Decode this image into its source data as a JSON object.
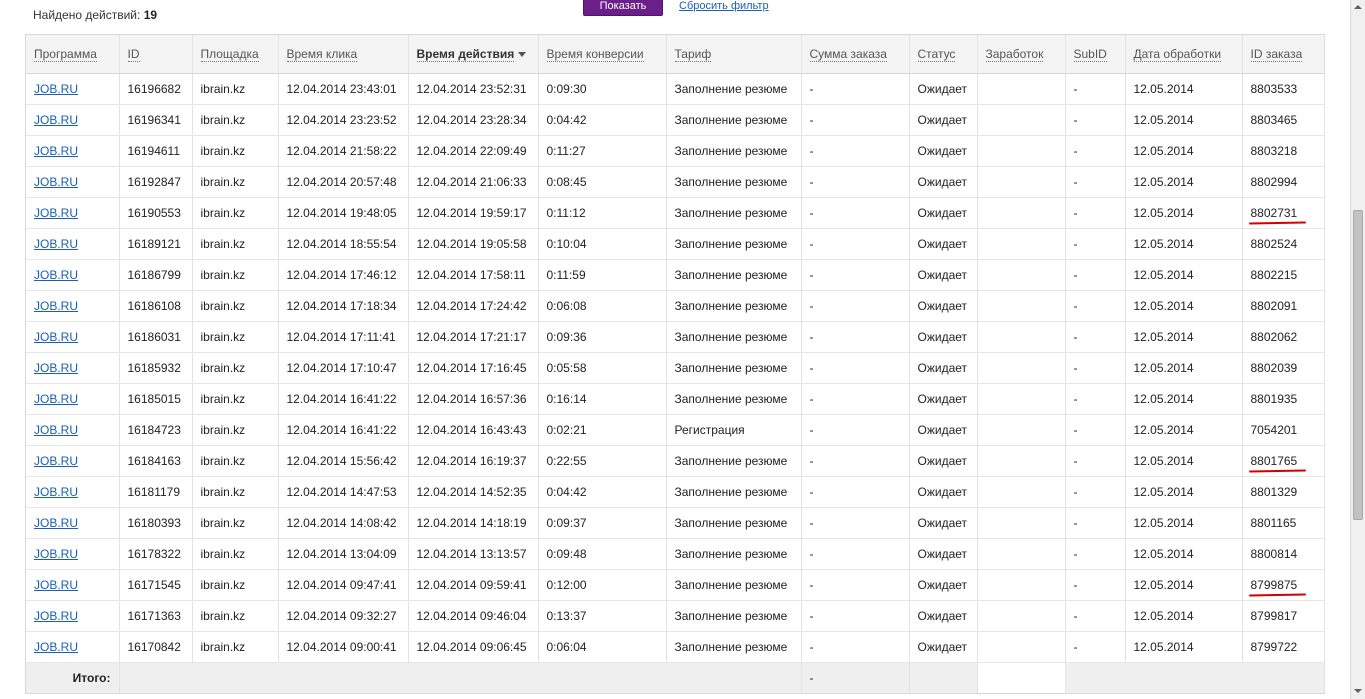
{
  "header": {
    "found_label": "Найдено действий:",
    "found_count": "19",
    "show_button": "Показать",
    "reset_link": "Сбросить фильтр"
  },
  "columns": [
    "Программа",
    "ID",
    "Площадка",
    "Время клика",
    "Время действия",
    "Время конверсии",
    "Тариф",
    "Сумма заказа",
    "Статус",
    "Заработок",
    "SubID",
    "Дата обработки",
    "ID заказа"
  ],
  "sorted_column": "Время действия",
  "rows": [
    {
      "program": "JOB.RU",
      "id": "16196682",
      "site": "ibrain.kz",
      "click_time": "12.04.2014 23:43:01",
      "action_time": "12.04.2014 23:52:31",
      "conversion_time": "0:09:30",
      "tariff": "Заполнение резюме",
      "order_sum": "-",
      "status": "Ожидает",
      "earnings": "",
      "subid": "-",
      "processed_date": "12.05.2014",
      "order_id": "8803533",
      "marked": false
    },
    {
      "program": "JOB.RU",
      "id": "16196341",
      "site": "ibrain.kz",
      "click_time": "12.04.2014 23:23:52",
      "action_time": "12.04.2014 23:28:34",
      "conversion_time": "0:04:42",
      "tariff": "Заполнение резюме",
      "order_sum": "-",
      "status": "Ожидает",
      "earnings": "",
      "subid": "-",
      "processed_date": "12.05.2014",
      "order_id": "8803465",
      "marked": false
    },
    {
      "program": "JOB.RU",
      "id": "16194611",
      "site": "ibrain.kz",
      "click_time": "12.04.2014 21:58:22",
      "action_time": "12.04.2014 22:09:49",
      "conversion_time": "0:11:27",
      "tariff": "Заполнение резюме",
      "order_sum": "-",
      "status": "Ожидает",
      "earnings": "",
      "subid": "-",
      "processed_date": "12.05.2014",
      "order_id": "8803218",
      "marked": false
    },
    {
      "program": "JOB.RU",
      "id": "16192847",
      "site": "ibrain.kz",
      "click_time": "12.04.2014 20:57:48",
      "action_time": "12.04.2014 21:06:33",
      "conversion_time": "0:08:45",
      "tariff": "Заполнение резюме",
      "order_sum": "-",
      "status": "Ожидает",
      "earnings": "",
      "subid": "-",
      "processed_date": "12.05.2014",
      "order_id": "8802994",
      "marked": false
    },
    {
      "program": "JOB.RU",
      "id": "16190553",
      "site": "ibrain.kz",
      "click_time": "12.04.2014 19:48:05",
      "action_time": "12.04.2014 19:59:17",
      "conversion_time": "0:11:12",
      "tariff": "Заполнение резюме",
      "order_sum": "-",
      "status": "Ожидает",
      "earnings": "",
      "subid": "-",
      "processed_date": "12.05.2014",
      "order_id": "8802731",
      "marked": true
    },
    {
      "program": "JOB.RU",
      "id": "16189121",
      "site": "ibrain.kz",
      "click_time": "12.04.2014 18:55:54",
      "action_time": "12.04.2014 19:05:58",
      "conversion_time": "0:10:04",
      "tariff": "Заполнение резюме",
      "order_sum": "-",
      "status": "Ожидает",
      "earnings": "",
      "subid": "-",
      "processed_date": "12.05.2014",
      "order_id": "8802524",
      "marked": false
    },
    {
      "program": "JOB.RU",
      "id": "16186799",
      "site": "ibrain.kz",
      "click_time": "12.04.2014 17:46:12",
      "action_time": "12.04.2014 17:58:11",
      "conversion_time": "0:11:59",
      "tariff": "Заполнение резюме",
      "order_sum": "-",
      "status": "Ожидает",
      "earnings": "",
      "subid": "-",
      "processed_date": "12.05.2014",
      "order_id": "8802215",
      "marked": false
    },
    {
      "program": "JOB.RU",
      "id": "16186108",
      "site": "ibrain.kz",
      "click_time": "12.04.2014 17:18:34",
      "action_time": "12.04.2014 17:24:42",
      "conversion_time": "0:06:08",
      "tariff": "Заполнение резюме",
      "order_sum": "-",
      "status": "Ожидает",
      "earnings": "",
      "subid": "-",
      "processed_date": "12.05.2014",
      "order_id": "8802091",
      "marked": false
    },
    {
      "program": "JOB.RU",
      "id": "16186031",
      "site": "ibrain.kz",
      "click_time": "12.04.2014 17:11:41",
      "action_time": "12.04.2014 17:21:17",
      "conversion_time": "0:09:36",
      "tariff": "Заполнение резюме",
      "order_sum": "-",
      "status": "Ожидает",
      "earnings": "",
      "subid": "-",
      "processed_date": "12.05.2014",
      "order_id": "8802062",
      "marked": false
    },
    {
      "program": "JOB.RU",
      "id": "16185932",
      "site": "ibrain.kz",
      "click_time": "12.04.2014 17:10:47",
      "action_time": "12.04.2014 17:16:45",
      "conversion_time": "0:05:58",
      "tariff": "Заполнение резюме",
      "order_sum": "-",
      "status": "Ожидает",
      "earnings": "",
      "subid": "-",
      "processed_date": "12.05.2014",
      "order_id": "8802039",
      "marked": false
    },
    {
      "program": "JOB.RU",
      "id": "16185015",
      "site": "ibrain.kz",
      "click_time": "12.04.2014 16:41:22",
      "action_time": "12.04.2014 16:57:36",
      "conversion_time": "0:16:14",
      "tariff": "Заполнение резюме",
      "order_sum": "-",
      "status": "Ожидает",
      "earnings": "",
      "subid": "-",
      "processed_date": "12.05.2014",
      "order_id": "8801935",
      "marked": false
    },
    {
      "program": "JOB.RU",
      "id": "16184723",
      "site": "ibrain.kz",
      "click_time": "12.04.2014 16:41:22",
      "action_time": "12.04.2014 16:43:43",
      "conversion_time": "0:02:21",
      "tariff": "Регистрация",
      "order_sum": "-",
      "status": "Ожидает",
      "earnings": "",
      "subid": "-",
      "processed_date": "12.05.2014",
      "order_id": "7054201",
      "marked": false
    },
    {
      "program": "JOB.RU",
      "id": "16184163",
      "site": "ibrain.kz",
      "click_time": "12.04.2014 15:56:42",
      "action_time": "12.04.2014 16:19:37",
      "conversion_time": "0:22:55",
      "tariff": "Заполнение резюме",
      "order_sum": "-",
      "status": "Ожидает",
      "earnings": "",
      "subid": "-",
      "processed_date": "12.05.2014",
      "order_id": "8801765",
      "marked": true
    },
    {
      "program": "JOB.RU",
      "id": "16181179",
      "site": "ibrain.kz",
      "click_time": "12.04.2014 14:47:53",
      "action_time": "12.04.2014 14:52:35",
      "conversion_time": "0:04:42",
      "tariff": "Заполнение резюме",
      "order_sum": "-",
      "status": "Ожидает",
      "earnings": "",
      "subid": "-",
      "processed_date": "12.05.2014",
      "order_id": "8801329",
      "marked": false
    },
    {
      "program": "JOB.RU",
      "id": "16180393",
      "site": "ibrain.kz",
      "click_time": "12.04.2014 14:08:42",
      "action_time": "12.04.2014 14:18:19",
      "conversion_time": "0:09:37",
      "tariff": "Заполнение резюме",
      "order_sum": "-",
      "status": "Ожидает",
      "earnings": "",
      "subid": "-",
      "processed_date": "12.05.2014",
      "order_id": "8801165",
      "marked": false
    },
    {
      "program": "JOB.RU",
      "id": "16178322",
      "site": "ibrain.kz",
      "click_time": "12.04.2014 13:04:09",
      "action_time": "12.04.2014 13:13:57",
      "conversion_time": "0:09:48",
      "tariff": "Заполнение резюме",
      "order_sum": "-",
      "status": "Ожидает",
      "earnings": "",
      "subid": "-",
      "processed_date": "12.05.2014",
      "order_id": "8800814",
      "marked": false
    },
    {
      "program": "JOB.RU",
      "id": "16171545",
      "site": "ibrain.kz",
      "click_time": "12.04.2014 09:47:41",
      "action_time": "12.04.2014 09:59:41",
      "conversion_time": "0:12:00",
      "tariff": "Заполнение резюме",
      "order_sum": "-",
      "status": "Ожидает",
      "earnings": "",
      "subid": "-",
      "processed_date": "12.05.2014",
      "order_id": "8799875",
      "marked": true
    },
    {
      "program": "JOB.RU",
      "id": "16171363",
      "site": "ibrain.kz",
      "click_time": "12.04.2014 09:32:27",
      "action_time": "12.04.2014 09:46:04",
      "conversion_time": "0:13:37",
      "tariff": "Заполнение резюме",
      "order_sum": "-",
      "status": "Ожидает",
      "earnings": "",
      "subid": "-",
      "processed_date": "12.05.2014",
      "order_id": "8799817",
      "marked": false
    },
    {
      "program": "JOB.RU",
      "id": "16170842",
      "site": "ibrain.kz",
      "click_time": "12.04.2014 09:00:41",
      "action_time": "12.04.2014 09:06:45",
      "conversion_time": "0:06:04",
      "tariff": "Заполнение резюме",
      "order_sum": "-",
      "status": "Ожидает",
      "earnings": "",
      "subid": "-",
      "processed_date": "12.05.2014",
      "order_id": "8799722",
      "marked": false
    }
  ],
  "totals": {
    "label": "Итого:",
    "order_sum": "-"
  },
  "colors": {
    "button_bg": "#6a1f8a",
    "link": "#1a5fb4",
    "annotation_underline": "#d40000"
  }
}
